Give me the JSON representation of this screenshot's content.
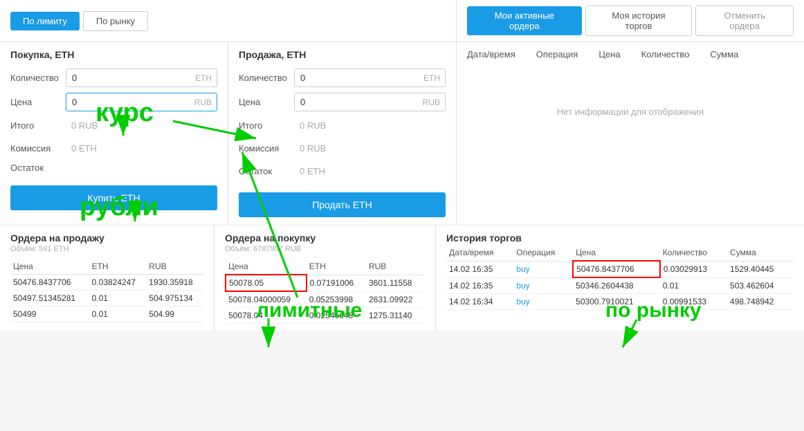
{
  "tabs": {
    "by_limit": "По лимиту",
    "by_market": "По рынку",
    "my_active_orders": "Мои активные ордера",
    "my_trade_history": "Моя история торгов",
    "cancel_order": "Отменить ордера"
  },
  "buy_panel": {
    "title": "Покупка, ETH",
    "quantity_label": "Количество",
    "quantity_value": "0",
    "quantity_suffix": "ETH",
    "price_label": "Цена",
    "price_value": "0",
    "price_suffix": "RUB",
    "total_label": "Итого",
    "total_value": "0",
    "total_suffix": "RUB",
    "commission_label": "Комиссия",
    "commission_value": "0",
    "commission_suffix": "ETH",
    "remainder_label": "Остаток",
    "remainder_value": "",
    "remainder_suffix": "",
    "buy_button": "Купить ETH"
  },
  "sell_panel": {
    "title": "Продажа, ETH",
    "quantity_label": "Количество",
    "quantity_value": "0",
    "quantity_suffix": "ETH",
    "price_label": "Цена",
    "price_value": "0",
    "price_suffix": "RUB",
    "total_label": "Итого",
    "total_value": "0",
    "total_suffix": "RUB",
    "commission_label": "Комиссия",
    "commission_value": "0",
    "commission_suffix": "RUB",
    "remainder_label": "Остаток",
    "remainder_value": "0",
    "remainder_suffix": "ETH",
    "sell_button": "Продать ETH"
  },
  "active_orders": {
    "no_info": "Нет информации для отображения",
    "columns": [
      "Дата/время",
      "Операция",
      "Цена",
      "Количество",
      "Сумма"
    ]
  },
  "orders_sell": {
    "title": "Ордера на продажу",
    "subtitle": "Объём: 591 ETH",
    "columns": [
      "Цена",
      "ETH",
      "RUB"
    ],
    "rows": [
      [
        "50476.8437706",
        "0.03824247",
        "1930.35918"
      ],
      [
        "50497.51345281",
        "0.01",
        "504.975134"
      ],
      [
        "50499",
        "0.01",
        "504.99"
      ]
    ]
  },
  "orders_buy": {
    "title": "Ордера на покупку",
    "subtitle": "Объём: 6787957 RUB",
    "columns": [
      "Цена",
      "ETH",
      "RUB"
    ],
    "rows": [
      [
        "50078.05",
        "0.07191006",
        "3601.11558"
      ],
      [
        "50078.04000059",
        "0.05253998",
        "2631.09922"
      ],
      [
        "50078.04",
        "0.02546648",
        "1275.31140"
      ]
    ],
    "highlighted_row": 0
  },
  "history": {
    "title": "История торгов",
    "columns": [
      "Дата/время",
      "Операция",
      "Цена",
      "Количество",
      "Сумма"
    ],
    "rows": [
      [
        "14.02 16:35",
        "buy",
        "50476.8437706",
        "0.03029913",
        "1529.40445"
      ],
      [
        "14.02 16:35",
        "buy",
        "50346.2604438",
        "0.01",
        "503.462604"
      ],
      [
        "14.02 16:34",
        "buy",
        "50300.7910021",
        "0.00991533",
        "498.748942"
      ]
    ],
    "highlighted_price_row": 0
  },
  "annotations": {
    "курс": "курс",
    "рубли": "рубли",
    "лимитные": "лимитные",
    "по_рынку": "по рынку"
  }
}
